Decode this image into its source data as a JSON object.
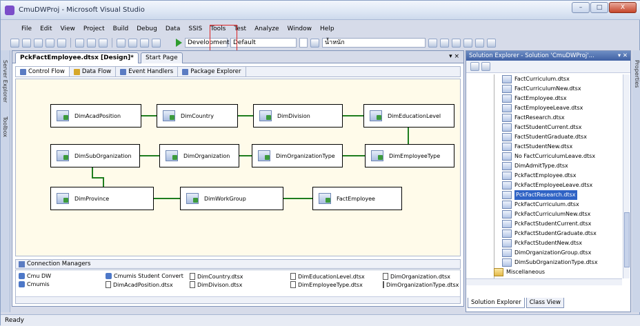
{
  "window": {
    "title": "CmuDWProj - Microsoft Visual Studio",
    "controls": {
      "minimize": "–",
      "maximize": "□",
      "close": "X"
    }
  },
  "menu": [
    "File",
    "Edit",
    "View",
    "Project",
    "Build",
    "Debug",
    "Data",
    "SSIS",
    "Tools",
    "Test",
    "Analyze",
    "Window",
    "Help"
  ],
  "toolbar": {
    "config": "Development",
    "platform": "Default",
    "find": "น้ำหนัก"
  },
  "left_strip": {
    "server_explorer": "Server Explorer",
    "toolbox": "Toolbox"
  },
  "document": {
    "tabs": [
      {
        "label": "PckFactEmployee.dtsx [Design]*",
        "active": true
      },
      {
        "label": "Start Page",
        "active": false
      }
    ],
    "controls": "▾ ×",
    "designer_tabs": [
      {
        "label": "Control Flow",
        "active": true
      },
      {
        "label": "Data Flow",
        "active": false
      },
      {
        "label": "Event Handlers",
        "active": false
      },
      {
        "label": "Package Explorer",
        "active": false
      }
    ],
    "tasks": {
      "acad": "DimAcadPosition",
      "country": "DimCountry",
      "division": "DimDivision",
      "edulevel": "DimEducationLevel",
      "suborg": "DimSubOrganization",
      "org": "DimOrganization",
      "orgtype": "DimOrganizationType",
      "emptype": "DimEmployeeType",
      "province": "DimProvince",
      "workgroup": "DimWorkGroup",
      "fact": "FactEmployee"
    },
    "connection_managers": {
      "header": "Connection Managers",
      "items": [
        "Cmu DW",
        "Cmumis",
        "Cmumis Student Convert",
        "DimAcadPosition.dtsx",
        "DimCountry.dtsx",
        "DimDivison.dtsx",
        "DimEducationLevel.dtsx",
        "DimEmployeeType.dtsx",
        "DimOrganization.dtsx",
        "DimOrganizationType.dtsx"
      ]
    }
  },
  "solution_explorer": {
    "title": "Solution Explorer - Solution 'CmuDWProj'...",
    "controls": "▾ ✕",
    "items": [
      "FactCurriculum.dtsx",
      "FactCurriculumNew.dtsx",
      "FactEmployee.dtsx",
      "FactEmployeeLeave.dtsx",
      "FactResearch.dtsx",
      "FactStudentCurrent.dtsx",
      "FactStudentGraduate.dtsx",
      "FactStudentNew.dtsx",
      "No FactCurriculumLeave.dtsx",
      "DimAdmitType.dtsx",
      "PckFactEmployee.dtsx",
      "PckFactEmployeeLeave.dtsx",
      "PckFactResearch.dtsx",
      "PckFactCurriculum.dtsx",
      "PckFactCurriculumNew.dtsx",
      "PckFactStudentCurrent.dtsx",
      "PckFactStudentGraduate.dtsx",
      "PckFactStudentNew.dtsx",
      "DimOrganizationGroup.dtsx",
      "DimSubOrganizationType.dtsx",
      "Miscellaneous"
    ],
    "selected_index": 12,
    "tabs": [
      "Solution Explorer",
      "Class View"
    ]
  },
  "right_strip": {
    "properties": "Properties"
  },
  "status": "Ready"
}
